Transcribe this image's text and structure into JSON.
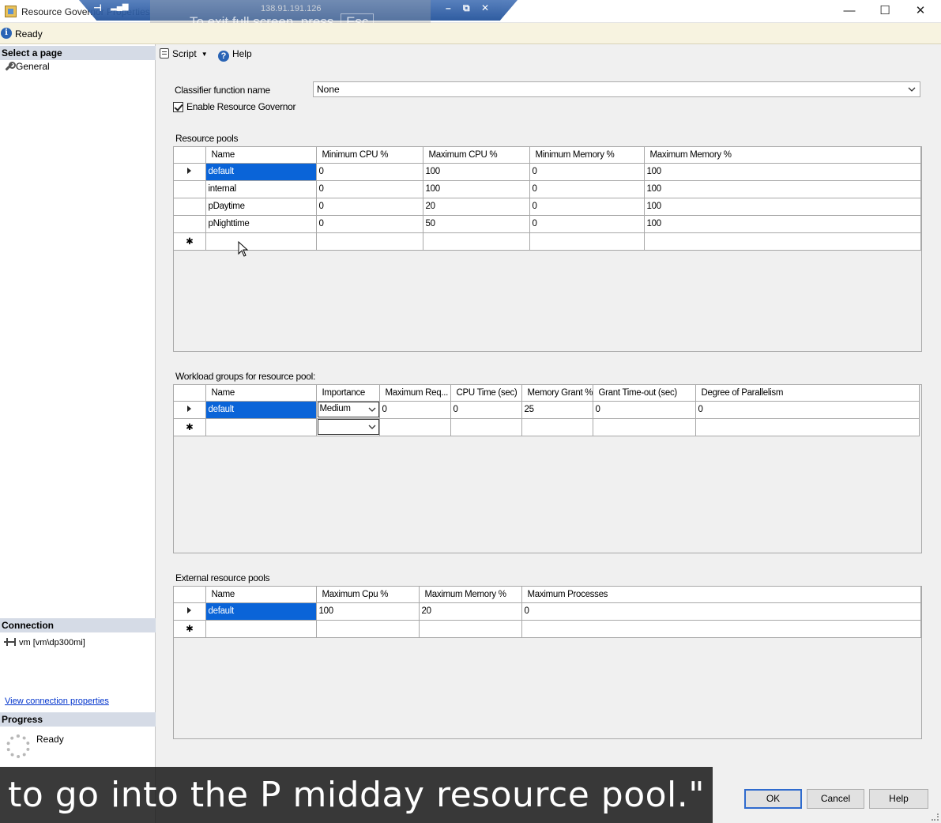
{
  "window": {
    "title": "Resource Governor Properties",
    "controls": {
      "minimize": "—",
      "maximize": "☐",
      "close": "✕"
    }
  },
  "rdp": {
    "host": "138.91.191.126",
    "fullscreen_hint": "To exit full screen, press",
    "esc_key": "Esc"
  },
  "status": {
    "text": "Ready"
  },
  "left_pane": {
    "select_page_header": "Select a page",
    "pages": [
      {
        "label": "General",
        "icon": "wrench-icon"
      }
    ],
    "connection_header": "Connection",
    "connection_value": "vm [vm\\dp300mi]",
    "view_connection_link": "View connection properties",
    "progress_header": "Progress",
    "progress_status": "Ready"
  },
  "toolbar": {
    "script_label": "Script",
    "help_label": "Help"
  },
  "form": {
    "classifier_label": "Classifier function name",
    "classifier_value": "None",
    "enable_label": "Enable Resource Governor",
    "enable_checked": true
  },
  "resource_pools": {
    "title": "Resource pools",
    "columns": [
      "Name",
      "Minimum CPU %",
      "Maximum CPU %",
      "Minimum Memory %",
      "Maximum Memory %"
    ],
    "rows": [
      [
        "default",
        "0",
        "100",
        "0",
        "100"
      ],
      [
        "internal",
        "0",
        "100",
        "0",
        "100"
      ],
      [
        "pDaytime",
        "0",
        "20",
        "0",
        "100"
      ],
      [
        "pNighttime",
        "0",
        "50",
        "0",
        "100"
      ]
    ]
  },
  "workload_groups": {
    "title": "Workload groups for resource pool:",
    "columns": [
      "Name",
      "Importance",
      "Maximum Req...",
      "CPU Time (sec)",
      "Memory Grant %",
      "Grant Time-out (sec)",
      "Degree of Parallelism"
    ],
    "rows": [
      [
        "default",
        "Medium",
        "0",
        "0",
        "25",
        "0",
        "0"
      ]
    ]
  },
  "external_pools": {
    "title": "External resource pools",
    "columns": [
      "Name",
      "Maximum Cpu %",
      "Maximum Memory %",
      "Maximum Processes"
    ],
    "rows": [
      [
        "default",
        "100",
        "20",
        "0"
      ]
    ]
  },
  "buttons": {
    "ok": "OK",
    "cancel": "Cancel",
    "help": "Help"
  },
  "caption": {
    "text": "ces to go into the P midday resource pool.\""
  },
  "colors": {
    "selection": "#0a64d8",
    "section_header": "#d5dbe6",
    "status_bg": "#f7f3e0"
  }
}
